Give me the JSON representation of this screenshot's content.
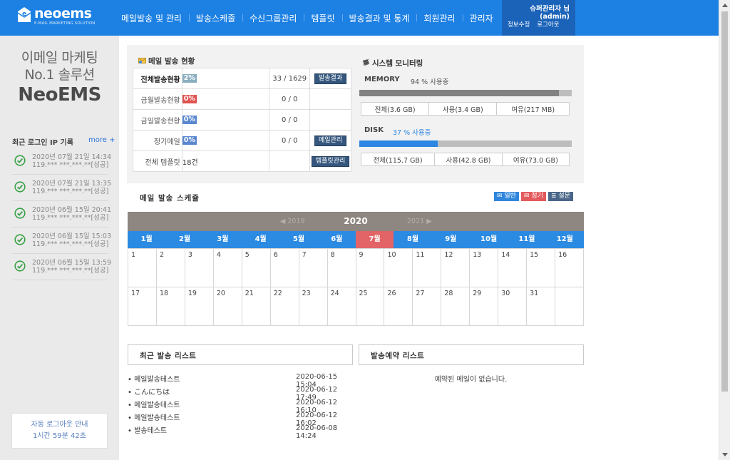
{
  "brand": {
    "name": "neoems",
    "sub": "E-MAIL MARKETING SOLUTION"
  },
  "nav": [
    {
      "label": "메일발송 및 관리"
    },
    {
      "label": "발송스케줄"
    },
    {
      "label": "수신그룹관리"
    },
    {
      "label": "템플릿"
    },
    {
      "label": "발송결과 및 통계"
    },
    {
      "label": "회원관리"
    },
    {
      "label": "관리자"
    }
  ],
  "user": {
    "name": "슈퍼관리자 님",
    "id": "(admin)",
    "edit": "정보수정",
    "logout": "로그아웃"
  },
  "sidebar": {
    "slogan1": "이메일 마케팅",
    "slogan2": "No.1 솔루션",
    "slogan3": "NeoEMS",
    "login_title": "최근 로그인 IP 기록",
    "more": "more +",
    "logins": [
      {
        "date": "2020년 07월 21일 14:34",
        "ip": "119.*** ***.***.**[성공]"
      },
      {
        "date": "2020년 07월 21일 13:35",
        "ip": "119.*** ***.***.**[성공]"
      },
      {
        "date": "2020년 06월 15일 20:41",
        "ip": "119.*** ***.***.**[성공]"
      },
      {
        "date": "2020년 06월 15일 15:03",
        "ip": "119.*** ***.***.**[성공]"
      },
      {
        "date": "2020년 06월 15일 13:59",
        "ip": "119.*** ***.***.**[성공]"
      }
    ],
    "autologout_title": "자동 로그아웃 안내",
    "autologout_time": "1시간 59분 42초"
  },
  "send_status": {
    "title": "메일 발송 현황",
    "rows": [
      {
        "label": "전체발송현황",
        "pct": "2%",
        "pct_color": "#8aaec0",
        "count": "33 / 1629",
        "action": "발송결과"
      },
      {
        "label": "금월발송현황",
        "pct": "0%",
        "pct_color": "#e0524f",
        "count": "0 / 0",
        "action": ""
      },
      {
        "label": "금일발송현황",
        "pct": "0%",
        "pct_color": "#5a87cf",
        "count": "0 / 0",
        "action": ""
      },
      {
        "label": "정기메일",
        "pct": "0%",
        "pct_color": "#5a87cf",
        "count": "0 / 0",
        "action": "메일관리"
      },
      {
        "label": "전체 템플릿",
        "pct": "18건",
        "pct_color": "",
        "count": "",
        "action": "템플릿관리"
      }
    ]
  },
  "monitoring": {
    "title": "시스템 모니터링",
    "memory": {
      "label": "MEMORY",
      "usage_text": "94 % 사용중",
      "usage": 94,
      "total": "전체(3.6 GB)",
      "used": "사용(3.4 GB)",
      "free": "여유(217 MB)"
    },
    "disk": {
      "label": "DISK",
      "usage_text": "37 % 사용중",
      "usage": 37,
      "total": "전체(115.7 GB)",
      "used": "사용(42.8 GB)",
      "free": "여유(73.0 GB)"
    },
    "colors": {
      "memory": "#828282",
      "disk": "#2c86e2",
      "disk_text": "#2c86e2"
    }
  },
  "schedule": {
    "title": "메일 발송 스케쥴",
    "legend": [
      {
        "label": "일반",
        "color": "#2f86dc"
      },
      {
        "label": "정기",
        "color": "#e35b5d"
      },
      {
        "label": "설문",
        "color": "#4a6789"
      }
    ],
    "year_prev": "2019",
    "year": "2020",
    "year_next": "2021",
    "months": [
      "1월",
      "2월",
      "3월",
      "4월",
      "5월",
      "6월",
      "7월",
      "8월",
      "9월",
      "10월",
      "11월",
      "12월"
    ],
    "active_month": 6,
    "days_row1": [
      "1",
      "2",
      "3",
      "4",
      "5",
      "6",
      "7",
      "8",
      "9",
      "10",
      "11",
      "12",
      "13",
      "14",
      "15",
      "16"
    ],
    "days_row2": [
      "17",
      "18",
      "19",
      "20",
      "21",
      "22",
      "23",
      "24",
      "25",
      "26",
      "27",
      "28",
      "29",
      "30",
      "31",
      ""
    ]
  },
  "recent_list": {
    "title": "최근 발송 리스트",
    "items": [
      {
        "title": "• 메일발송테스트",
        "date": "2020-06-15 15:04"
      },
      {
        "title": "• こんにちは",
        "date": "2020-06-12 17:49"
      },
      {
        "title": "• 메일발송테스트",
        "date": "2020-06-12 16:10"
      },
      {
        "title": "• 메일발송테스트",
        "date": "2020-06-12 16:02"
      },
      {
        "title": "• 발송테스트",
        "date": "2020-06-08 14:24"
      }
    ]
  },
  "reserve_list": {
    "title": "발송예약 리스트",
    "empty": "예약된 메일이 없습니다."
  }
}
